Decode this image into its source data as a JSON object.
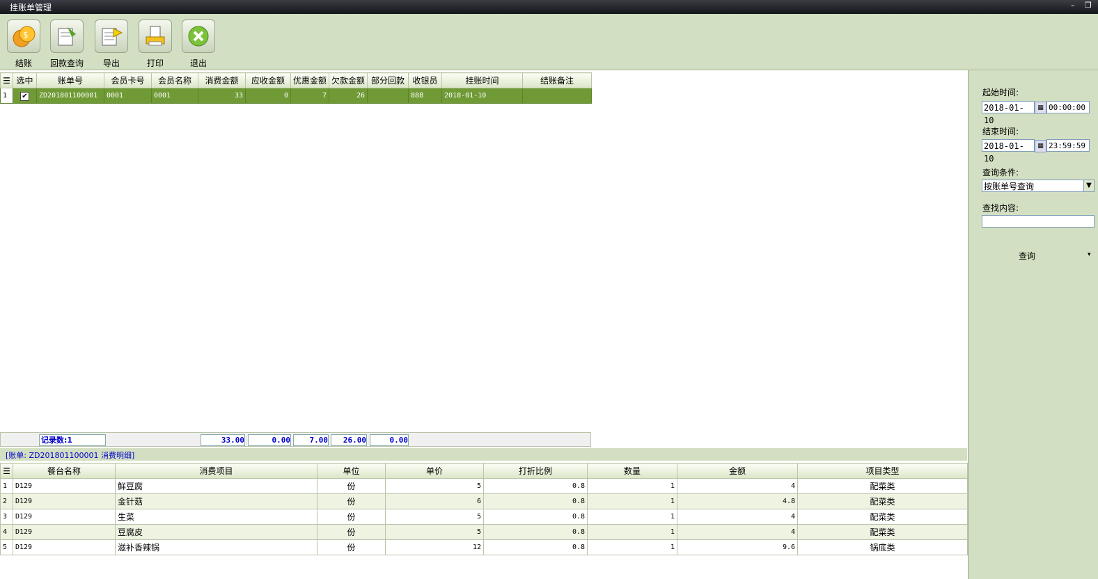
{
  "window": {
    "title": "挂账单管理",
    "min": "–",
    "restore": "❐"
  },
  "toolbar": {
    "buttons": [
      {
        "label": "结账"
      },
      {
        "label": "回款查询"
      },
      {
        "label": "导出"
      },
      {
        "label": "打印"
      },
      {
        "label": "退出"
      }
    ]
  },
  "master": {
    "columns": [
      "选中",
      "账单号",
      "会员卡号",
      "会员名称",
      "消费金额",
      "应收金额",
      "优惠金额",
      "欠款金额",
      "部分回款",
      "收银员",
      "挂账时间",
      "结账备注"
    ],
    "rows": [
      {
        "n": "1",
        "checked": "✔",
        "bill": "ZD201801100001",
        "card": "0001",
        "name": "0001",
        "consume": "33",
        "receivable": "0",
        "discount": "7",
        "debt": "26",
        "partial": "",
        "cashier": "888",
        "time": "2018-01-10",
        "note": ""
      }
    ],
    "summary": {
      "count": "记录数:1",
      "consume": "33.00",
      "receivable": "0.00",
      "discount": "7.00",
      "debt": "26.00",
      "partial": "0.00"
    }
  },
  "detail": {
    "caption": "[账单: ZD201801100001 消费明细]",
    "columns": [
      "餐台名称",
      "消费项目",
      "单位",
      "单价",
      "打折比例",
      "数量",
      "金额",
      "项目类型"
    ],
    "rows": [
      {
        "n": "1",
        "table": "D129",
        "item": "鲜豆腐",
        "unit": "份",
        "price": "5",
        "ratio": "0.8",
        "qty": "1",
        "amount": "4",
        "type": "配菜类"
      },
      {
        "n": "2",
        "table": "D129",
        "item": "金针菇",
        "unit": "份",
        "price": "6",
        "ratio": "0.8",
        "qty": "1",
        "amount": "4.8",
        "type": "配菜类"
      },
      {
        "n": "3",
        "table": "D129",
        "item": "生菜",
        "unit": "份",
        "price": "5",
        "ratio": "0.8",
        "qty": "1",
        "amount": "4",
        "type": "配菜类"
      },
      {
        "n": "4",
        "table": "D129",
        "item": "豆腐皮",
        "unit": "份",
        "price": "5",
        "ratio": "0.8",
        "qty": "1",
        "amount": "4",
        "type": "配菜类"
      },
      {
        "n": "5",
        "table": "D129",
        "item": "滋补香辣锅",
        "unit": "份",
        "price": "12",
        "ratio": "0.8",
        "qty": "1",
        "amount": "9.6",
        "type": "锅底类"
      }
    ]
  },
  "filter": {
    "start_label": "起始时间:",
    "start_date": "2018-01-10",
    "start_time": "00:00:00",
    "end_label": "结束时间:",
    "end_date": "2018-01-10",
    "end_time": "23:59:59",
    "cond_label": "查询条件:",
    "cond_value": "按账单号查询",
    "find_label": "查找内容:",
    "find_value": "",
    "query_button": "查询"
  }
}
